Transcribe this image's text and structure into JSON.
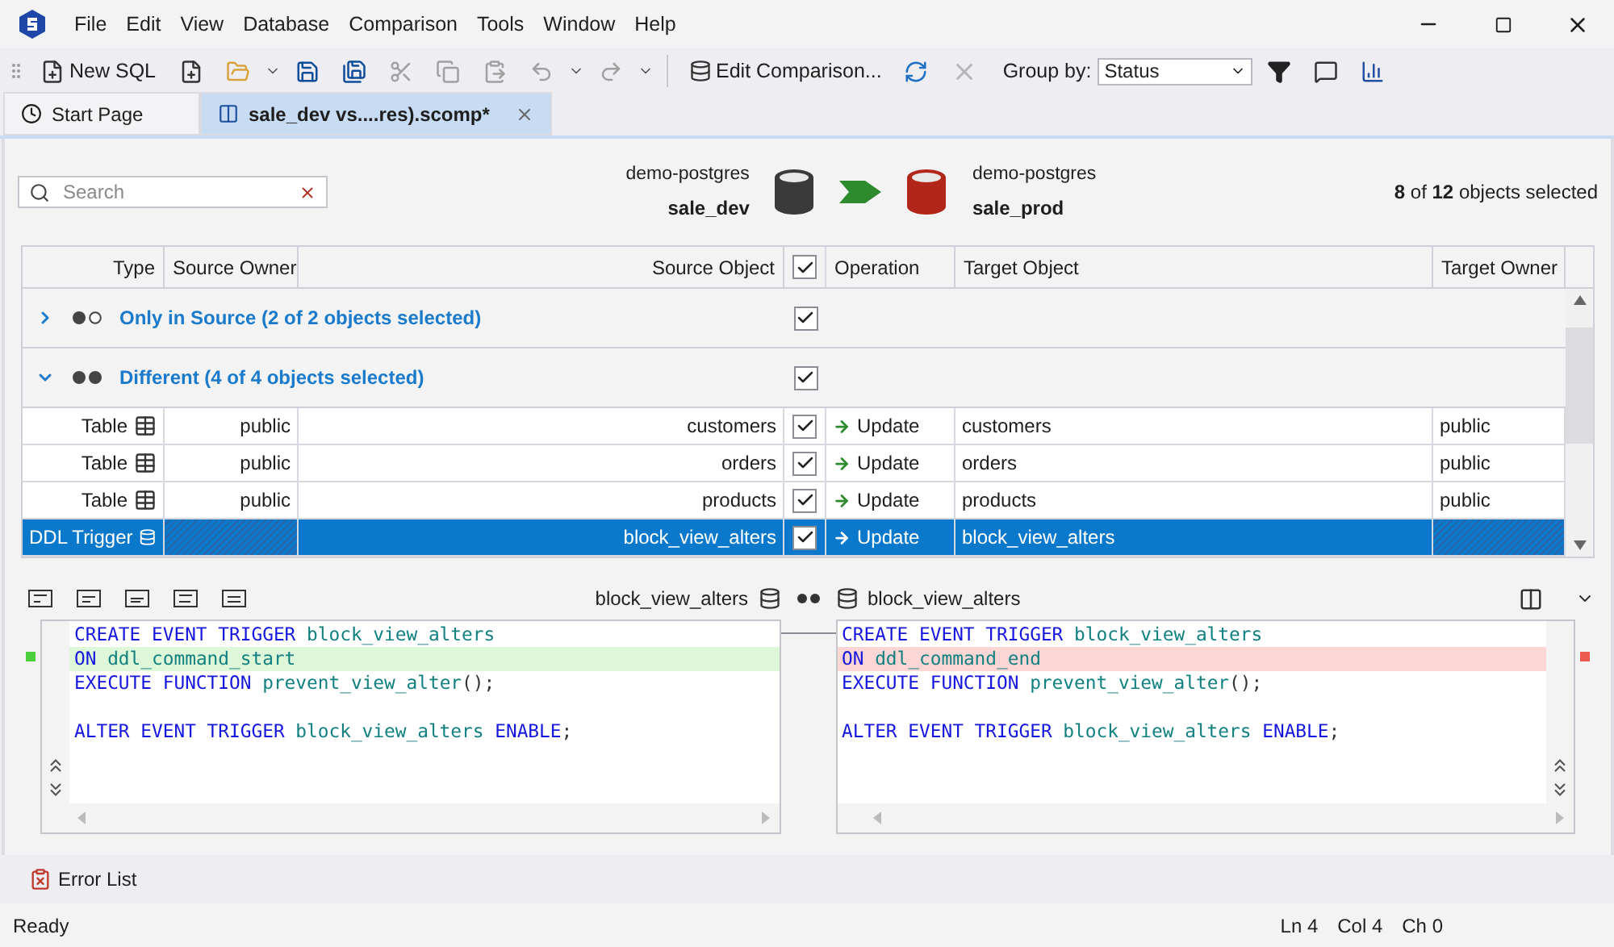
{
  "menu": [
    "File",
    "Edit",
    "View",
    "Database",
    "Comparison",
    "Tools",
    "Window",
    "Help"
  ],
  "toolbar": {
    "new_sql": "New SQL",
    "edit_comparison": "Edit Comparison...",
    "group_by_label": "Group by:",
    "group_by_value": "Status",
    "tools": [
      {
        "kind": "new_file",
        "disabled": false
      },
      {
        "kind": "open",
        "disabled": false
      },
      {
        "kind": "save",
        "disabled": false
      },
      {
        "kind": "save_all",
        "disabled": false
      },
      {
        "kind": "cut",
        "disabled": true
      },
      {
        "kind": "copy",
        "disabled": true
      },
      {
        "kind": "paste",
        "disabled": true
      },
      {
        "kind": "undo",
        "disabled": true
      },
      {
        "kind": "redo",
        "disabled": true
      }
    ]
  },
  "tabs": [
    {
      "label": "Start Page",
      "selected": false
    },
    {
      "label": "sale_dev vs....res).scomp*",
      "selected": true
    }
  ],
  "comparison": {
    "search_placeholder": "Search",
    "source": {
      "server": "demo-postgres",
      "database": "sale_dev"
    },
    "target": {
      "server": "demo-postgres",
      "database": "sale_prod"
    },
    "selection_count": "**8** of **12** objects selected"
  },
  "grid": {
    "columns": [
      "Type",
      "Source Owner",
      "Source Object",
      "Operation",
      "Target Object",
      "Target Owner"
    ],
    "header_checked": true,
    "groups": [
      {
        "kind": "source_only",
        "label": "Only in Source (2 of 2 objects selected)",
        "expanded": false,
        "checked": true
      },
      {
        "kind": "different",
        "label": "Different (4 of 4 objects selected)",
        "expanded": true,
        "checked": true,
        "rows": [
          {
            "kind": "table",
            "type": "Table",
            "source_owner": "public",
            "source_object": "customers",
            "checked": true,
            "operation": "Update",
            "target_object": "customers",
            "target_owner": "public",
            "selected": false
          },
          {
            "kind": "table",
            "type": "Table",
            "source_owner": "public",
            "source_object": "orders",
            "checked": true,
            "operation": "Update",
            "target_object": "orders",
            "target_owner": "public",
            "selected": false
          },
          {
            "kind": "table",
            "type": "Table",
            "source_owner": "public",
            "source_object": "products",
            "checked": true,
            "operation": "Update",
            "target_object": "products",
            "target_owner": "public",
            "selected": false
          },
          {
            "kind": "trigger",
            "type": "DDL Trigger",
            "source_object": "block_view_alters",
            "checked": true,
            "operation": "Update",
            "target_object": "block_view_alters",
            "selected": true
          }
        ]
      }
    ]
  },
  "diff": {
    "source_title": "block_view_alters",
    "target_title": "block_view_alters",
    "source_lines": [
      {
        "changed": false,
        "tokens": [
          {
            "kind": "keyword",
            "text": "CREATE EVENT TRIGGER "
          },
          {
            "kind": "name",
            "text": "block_view_alters"
          }
        ]
      },
      {
        "changed": true,
        "tokens": [
          {
            "kind": "keyword",
            "text": "ON "
          },
          {
            "kind": "name",
            "text": "ddl_command_start"
          }
        ]
      },
      {
        "changed": false,
        "tokens": [
          {
            "kind": "keyword",
            "text": "EXECUTE FUNCTION "
          },
          {
            "kind": "name",
            "text": "prevent_view_alter"
          },
          {
            "kind": "punct",
            "text": "();"
          }
        ]
      },
      {
        "blank": true
      },
      {
        "changed": false,
        "tokens": [
          {
            "kind": "keyword",
            "text": "ALTER EVENT TRIGGER "
          },
          {
            "kind": "name",
            "text": "block_view_alters"
          },
          {
            "kind": "keyword",
            "text": " ENABLE"
          },
          {
            "kind": "punct",
            "text": ";"
          }
        ]
      }
    ],
    "target_lines": [
      {
        "changed": false,
        "tokens": [
          {
            "kind": "keyword",
            "text": "CREATE EVENT TRIGGER "
          },
          {
            "kind": "name",
            "text": "block_view_alters"
          }
        ]
      },
      {
        "changed": true,
        "tokens": [
          {
            "kind": "keyword",
            "text": "ON "
          },
          {
            "kind": "name",
            "text": "ddl_command_end"
          }
        ]
      },
      {
        "changed": false,
        "tokens": [
          {
            "kind": "keyword",
            "text": "EXECUTE FUNCTION "
          },
          {
            "kind": "name",
            "text": "prevent_view_alter"
          },
          {
            "kind": "punct",
            "text": "();"
          }
        ]
      },
      {
        "blank": true
      },
      {
        "changed": false,
        "tokens": [
          {
            "kind": "keyword",
            "text": "ALTER EVENT TRIGGER "
          },
          {
            "kind": "name",
            "text": "block_view_alters"
          },
          {
            "kind": "keyword",
            "text": " ENABLE"
          },
          {
            "kind": "punct",
            "text": ";"
          }
        ]
      }
    ]
  },
  "error_list": "Error List",
  "status_bar": {
    "text": "Ready",
    "line": "Ln 4",
    "column": "Col 4",
    "char": "Ch 0"
  }
}
